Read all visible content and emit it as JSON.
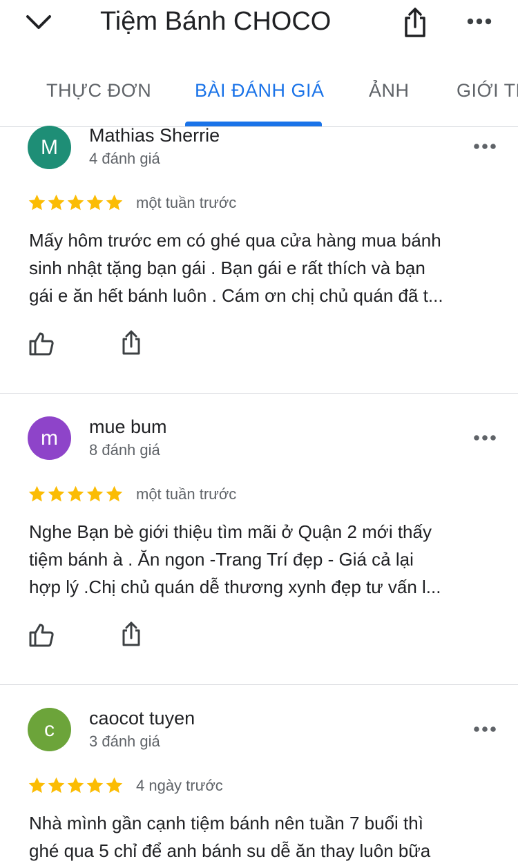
{
  "header": {
    "title": "Tiệm Bánh CHOCO",
    "back_icon": "chevron-down-icon",
    "share_icon": "share-icon",
    "more_icon": "more-horizontal-icon"
  },
  "tabs": [
    {
      "label": "THỰC ĐƠN",
      "active": false
    },
    {
      "label": "BÀI ĐÁNH GIÁ",
      "active": true
    },
    {
      "label": "ẢNH",
      "active": false
    },
    {
      "label": "GIỚI TH",
      "active": false
    }
  ],
  "colors": {
    "accent": "#1a73e8",
    "star": "#fbbc04",
    "text": "#202124",
    "secondary": "#5f6368"
  },
  "reviews": [
    {
      "avatar_letter": "M",
      "avatar_color": "#1e8e76",
      "name": "Mathias Sherrie",
      "count": "4 đánh giá",
      "rating": 5,
      "time": "một tuần trước",
      "lines": [
        "Mấy hôm trước em có ghé qua cửa hàng mua bánh",
        "sinh nhật tặng bạn gái . Bạn gái e rất thích và bạn",
        "gái e ăn hết bánh luôn . Cám ơn chị chủ quán đã t..."
      ]
    },
    {
      "avatar_letter": "m",
      "avatar_color": "#8e44c9",
      "name": "mue bum",
      "count": "8 đánh giá",
      "rating": 5,
      "time": "một tuần trước",
      "lines": [
        "Nghe Bạn bè giới thiệu tìm mãi ở Quận 2 mới thấy",
        "tiệm bánh à . Ăn ngon -Trang Trí đẹp - Giá cả lại",
        "hợp lý  .Chị chủ quán dễ thương xynh đẹp tư vấn l..."
      ]
    },
    {
      "avatar_letter": "c",
      "avatar_color": "#6ca43a",
      "name": "caocot tuyen",
      "count": "3 đánh giá",
      "rating": 5,
      "time": "4 ngày trước",
      "lines": [
        "Nhà mình gần cạnh tiệm bánh nên tuần 7 buổi thì",
        "ghé qua 5 chỉ để anh bánh su dễ ăn thay luôn bữa"
      ]
    }
  ]
}
